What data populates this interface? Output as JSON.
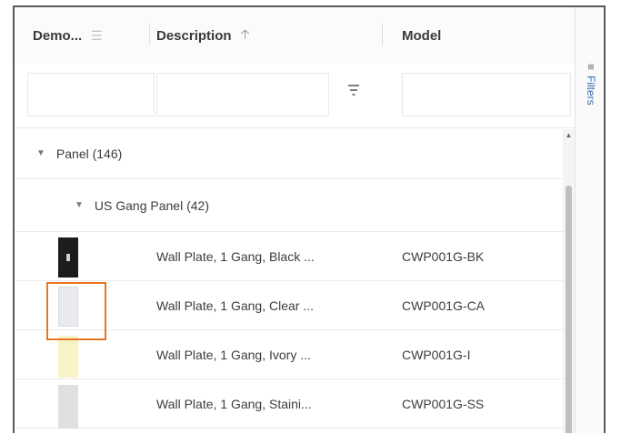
{
  "columns": {
    "demo": "Demo...",
    "description": "Description",
    "model": "Model"
  },
  "groups": {
    "level1": "Panel (146)",
    "level2": "US Gang Panel (42)"
  },
  "rows": [
    {
      "description": "Wall Plate, 1 Gang, Black ...",
      "model": "CWP001G-BK",
      "swatch": "#1c1c1c"
    },
    {
      "description": "Wall Plate, 1 Gang, Clear ...",
      "model": "CWP001G-CA",
      "swatch": "#e9eaee"
    },
    {
      "description": "Wall Plate, 1 Gang, Ivory ...",
      "model": "CWP001G-I",
      "swatch": "#fbf3c8"
    },
    {
      "description": "Wall Plate, 1 Gang, Staini...",
      "model": "CWP001G-SS",
      "swatch": "#dfe0e2"
    }
  ],
  "side_panel": {
    "filters_label": "Filters"
  },
  "colors": {
    "highlight": "#e87722",
    "link": "#3b6fb5"
  }
}
